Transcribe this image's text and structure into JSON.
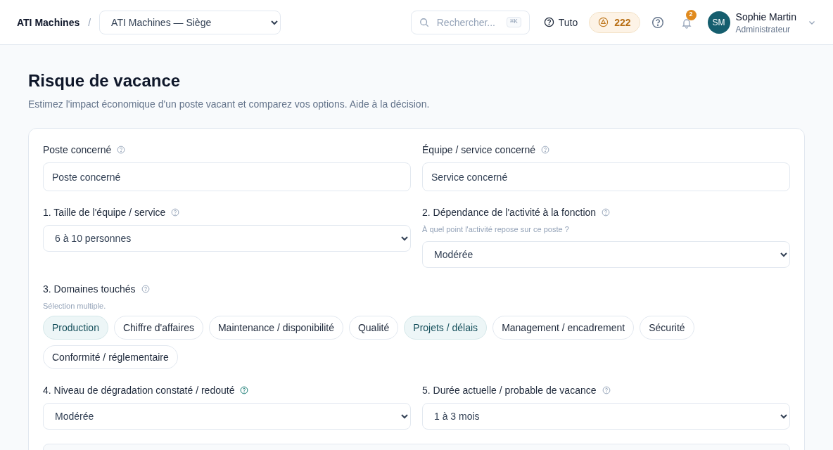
{
  "header": {
    "brand": "ATI Machines",
    "separator": "/",
    "site_select": "ATI Machines — Siège",
    "search": {
      "placeholder": "Rechercher...",
      "shortcut": "⌘K"
    },
    "tuto": "Tuto",
    "points": "222",
    "notifications": "2",
    "user": {
      "initials": "SM",
      "name": "Sophie Martin",
      "role": "Administrateur"
    }
  },
  "page": {
    "title": "Risque de vacance",
    "subtitle": "Estimez l'impact économique d'un poste vacant et comparez vos options. Aide à la décision."
  },
  "form": {
    "rows": [
      [
        {
          "kind": "input",
          "label": "Poste concerné",
          "help_active": false,
          "placeholder": "Poste concerné"
        },
        {
          "kind": "input",
          "label": "Équipe / service concerné",
          "help_active": false,
          "placeholder": "Service concerné"
        }
      ],
      [
        {
          "kind": "select",
          "label": "1. Taille de l'équipe / service",
          "help_active": false,
          "value": "6 à 10 personnes"
        },
        {
          "kind": "select",
          "label": "2. Dépendance de l'activité à la fonction",
          "help_active": false,
          "hint": "À quel point l'activité repose sur ce poste ?",
          "value": "Modérée"
        }
      ],
      [
        {
          "kind": "chips",
          "label": "3. Domaines touchés",
          "help_active": false,
          "hint": "Sélection multiple.",
          "options": [
            {
              "label": "Production",
              "selected": true
            },
            {
              "label": "Chiffre d'affaires",
              "selected": false
            },
            {
              "label": "Maintenance / disponibilité",
              "selected": false
            },
            {
              "label": "Qualité",
              "selected": false
            },
            {
              "label": "Projets / délais",
              "selected": true
            },
            {
              "label": "Management / encadrement",
              "selected": false
            },
            {
              "label": "Sécurité",
              "selected": false
            },
            {
              "label": "Conformité / réglementaire",
              "selected": false
            }
          ]
        }
      ],
      [
        {
          "kind": "select",
          "label": "4. Niveau de dégradation constaté / redouté",
          "help_active": true,
          "value": "Modérée"
        },
        {
          "kind": "select",
          "label": "5. Durée actuelle / probable de vacance",
          "help_active": false,
          "value": "1 à 3 mois"
        }
      ]
    ]
  }
}
